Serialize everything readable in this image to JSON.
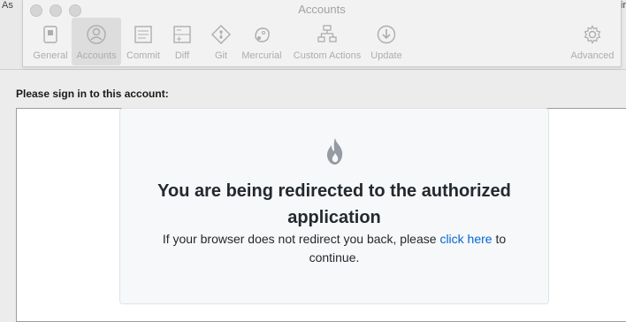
{
  "background_window": {
    "left_fragment": "As",
    "right_fragment": "ir"
  },
  "prefs_window": {
    "title": "Accounts",
    "toolbar": [
      {
        "label": "General",
        "icon": "general-icon"
      },
      {
        "label": "Accounts",
        "icon": "accounts-icon",
        "active": true
      },
      {
        "label": "Commit",
        "icon": "commit-icon"
      },
      {
        "label": "Diff",
        "icon": "diff-icon"
      },
      {
        "label": "Git",
        "icon": "git-icon"
      },
      {
        "label": "Mercurial",
        "icon": "mercurial-icon"
      },
      {
        "label": "Custom Actions",
        "icon": "custom-actions-icon"
      },
      {
        "label": "Update",
        "icon": "update-icon"
      },
      {
        "label": "Advanced",
        "icon": "advanced-icon"
      }
    ]
  },
  "signin": {
    "label": "Please sign in to this account:",
    "card": {
      "title": "You are being redirected to the authorized application",
      "text_before": "If your browser does not redirect you back, please ",
      "link": "click here",
      "text_after": " to continue."
    }
  },
  "colors": {
    "link": "#0366d6",
    "card_bg": "#f6f8fa",
    "icon_gray": "#a7a7a7"
  }
}
